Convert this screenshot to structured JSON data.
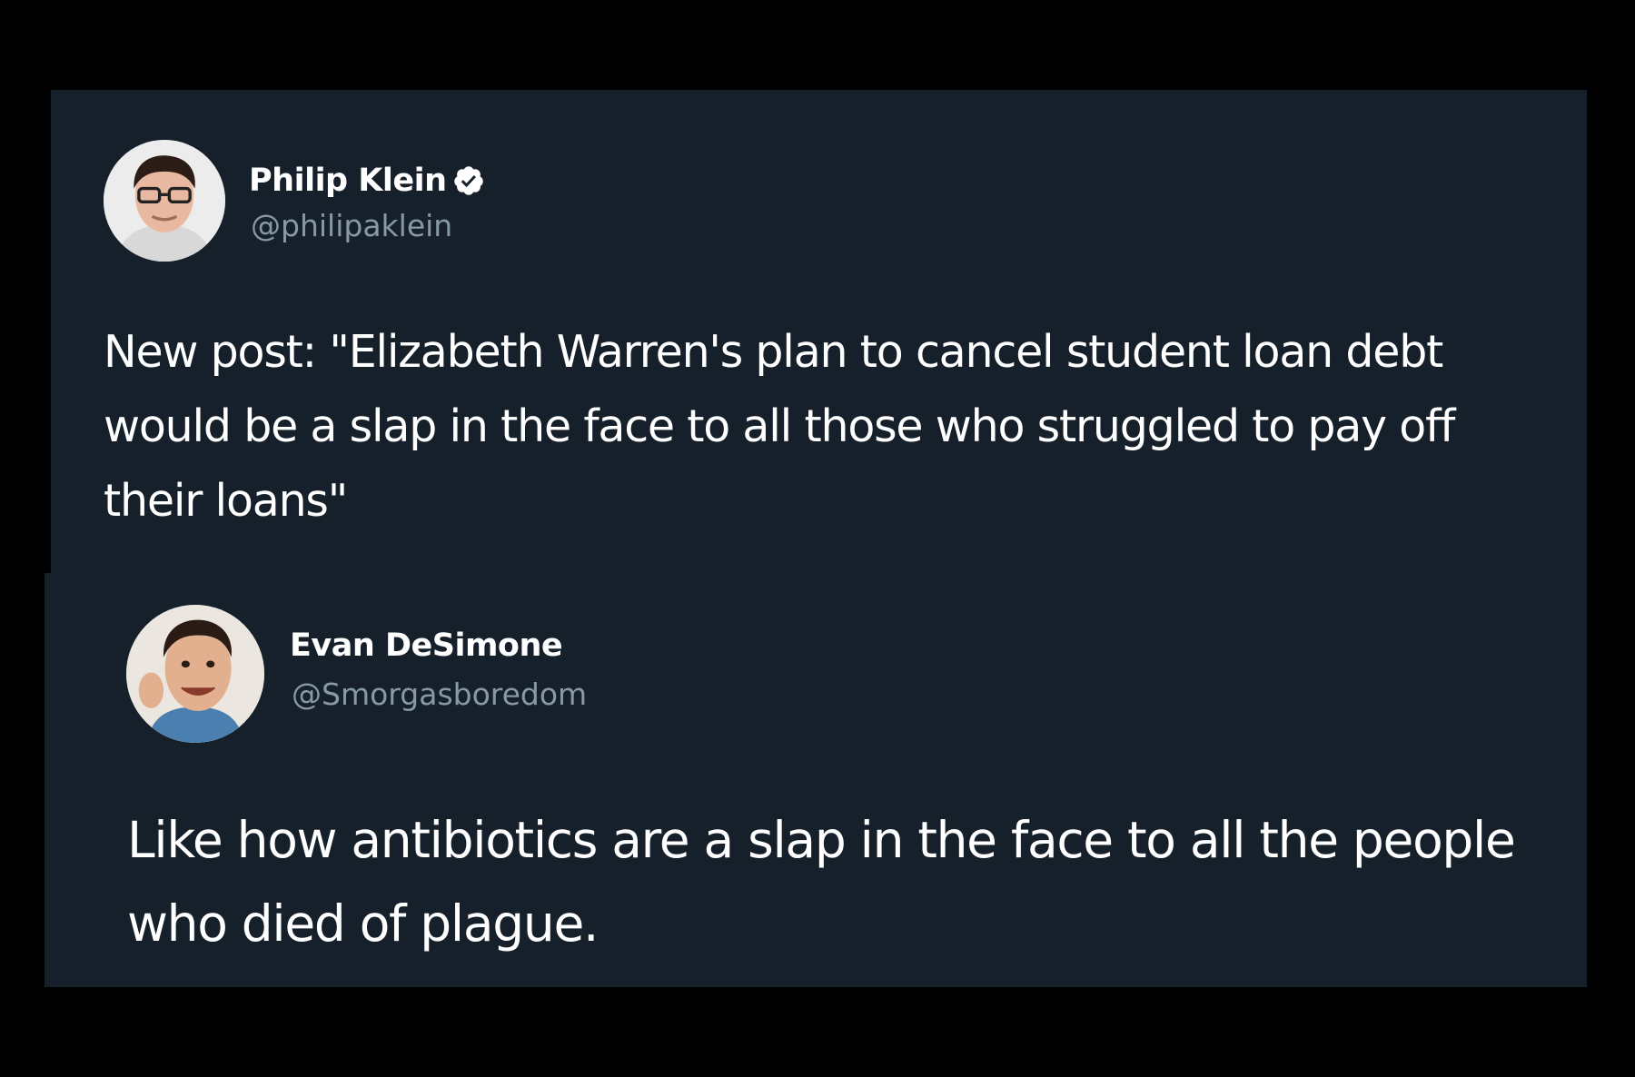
{
  "tweets": [
    {
      "author": {
        "display_name": "Philip Klein",
        "handle": "@philipaklein",
        "verified": true,
        "avatar_icon": "person-with-glasses-avatar"
      },
      "text": "New post: \"Elizabeth Warren's plan to cancel student loan debt would be a slap in the face to all those who struggled to pay off their loans\""
    },
    {
      "author": {
        "display_name": "Evan DeSimone",
        "handle": "@Smorgasboredom",
        "verified": false,
        "avatar_icon": "person-selfie-avatar"
      },
      "text": "Like how antibiotics are a slap in the face to all the people who died of plague."
    }
  ],
  "colors": {
    "page_background": "#000000",
    "card_background": "#15202b",
    "text_primary": "#ffffff",
    "text_secondary": "#8899a6",
    "verified_badge": "#ffffff"
  }
}
